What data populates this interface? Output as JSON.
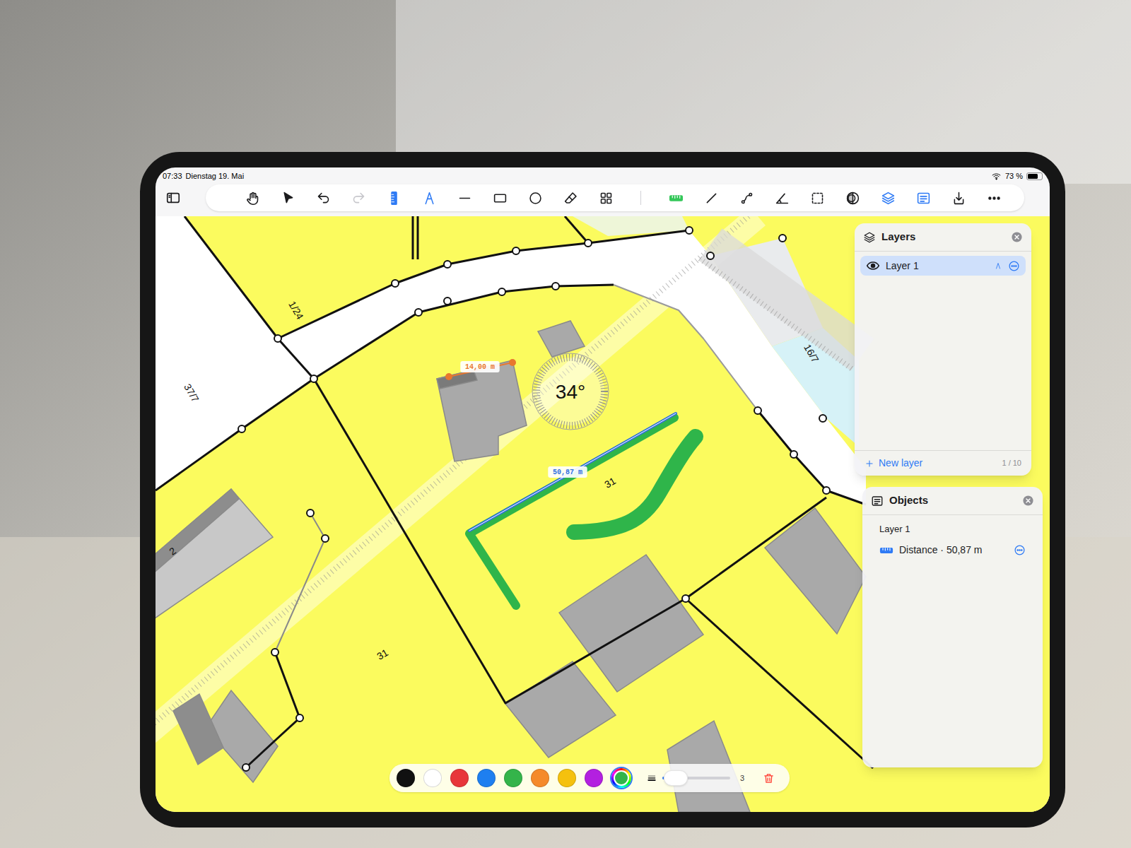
{
  "status_bar": {
    "time": "07:33",
    "date": "Dienstag 19. Mai",
    "battery": "73 %",
    "battery_level": 0.73,
    "wifi": true
  },
  "toolbar": {
    "tools": [
      {
        "active": false,
        "disabled": false
      },
      {
        "active": false,
        "disabled": false
      },
      {
        "active": false,
        "disabled": false
      },
      {
        "active": false,
        "disabled": true
      },
      {
        "active": true,
        "disabled": false
      },
      {
        "active": true,
        "disabled": false
      },
      {
        "active": false,
        "disabled": false
      },
      {
        "active": false,
        "disabled": false
      },
      {
        "active": false,
        "disabled": false
      },
      {
        "active": false,
        "disabled": false
      },
      {
        "active": false,
        "disabled": false
      },
      {
        "active": true,
        "disabled": false
      },
      {
        "active": false,
        "disabled": false
      },
      {
        "active": false,
        "disabled": false
      },
      {
        "active": false,
        "disabled": false
      },
      {
        "active": false,
        "disabled": false
      },
      {
        "active": false,
        "disabled": false
      },
      {
        "active": true,
        "disabled": false
      },
      {
        "active": true,
        "disabled": false
      },
      {
        "active": false,
        "disabled": false
      },
      {
        "active": false,
        "disabled": false
      }
    ]
  },
  "map": {
    "labels": [
      {
        "text": "1/24"
      },
      {
        "text": "37/7"
      },
      {
        "text": "16/7"
      },
      {
        "text": "31"
      },
      {
        "text": "31"
      },
      {
        "text": "2"
      }
    ],
    "measurements": [
      {
        "text": "14,00 m",
        "color": "#e8772e"
      },
      {
        "text": "50,87 m",
        "color": "#2f6fe0"
      }
    ],
    "angle": "34°"
  },
  "layers_panel": {
    "title": "Layers",
    "items": [
      {
        "name": "Layer 1",
        "visible": true,
        "selected": true
      }
    ],
    "new_layer": "New layer",
    "count": "1 / 10"
  },
  "objects_panel": {
    "title": "Objects",
    "groups": [
      {
        "layer": "Layer 1",
        "items": [
          {
            "label": "Distance · 50,87 m"
          }
        ]
      }
    ]
  },
  "palette": {
    "colors": [
      {
        "kind": "swatch",
        "color": "#111111",
        "selected": false
      },
      {
        "kind": "swatch",
        "color": "#ffffff",
        "selected": false
      },
      {
        "kind": "swatch",
        "color": "#e8363a",
        "selected": false
      },
      {
        "kind": "swatch",
        "color": "#1e7ff0",
        "selected": false
      },
      {
        "kind": "swatch",
        "color": "#34b44a",
        "selected": false
      },
      {
        "kind": "swatch",
        "color": "#f58a2a",
        "selected": false
      },
      {
        "kind": "swatch",
        "color": "#f5c10e",
        "selected": false
      },
      {
        "kind": "swatch",
        "color": "#b320e0",
        "selected": false
      },
      {
        "kind": "custom",
        "color": "#34b44a",
        "selected": true
      }
    ],
    "stroke": {
      "level": 0.2,
      "value": "3"
    }
  }
}
